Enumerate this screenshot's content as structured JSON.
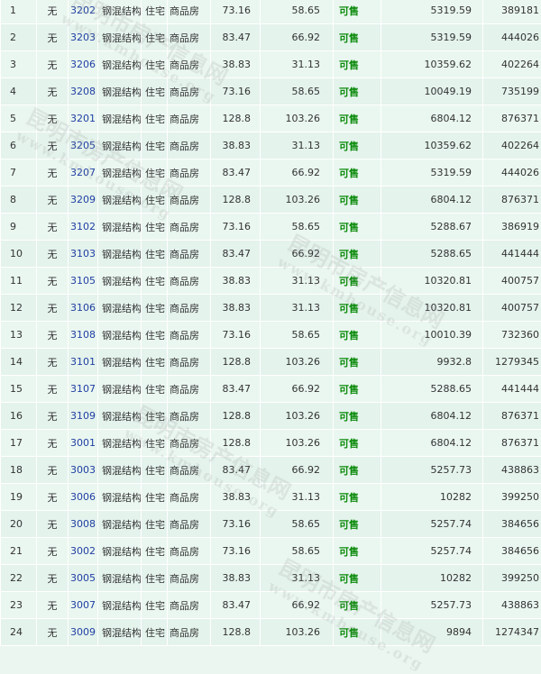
{
  "table": {
    "rows": [
      {
        "idx": "1",
        "has_none": "无",
        "room": "3202",
        "structure": "钢混结构",
        "use": "住宅",
        "type": "商品房",
        "area": "73.16",
        "inner_area": "58.65",
        "status": "可售",
        "unit_price": "5319.59",
        "total_price": "389181"
      },
      {
        "idx": "2",
        "has_none": "无",
        "room": "3203",
        "structure": "钢混结构",
        "use": "住宅",
        "type": "商品房",
        "area": "83.47",
        "inner_area": "66.92",
        "status": "可售",
        "unit_price": "5319.59",
        "total_price": "444026"
      },
      {
        "idx": "3",
        "has_none": "无",
        "room": "3206",
        "structure": "钢混结构",
        "use": "住宅",
        "type": "商品房",
        "area": "38.83",
        "inner_area": "31.13",
        "status": "可售",
        "unit_price": "10359.62",
        "total_price": "402264"
      },
      {
        "idx": "4",
        "has_none": "无",
        "room": "3208",
        "structure": "钢混结构",
        "use": "住宅",
        "type": "商品房",
        "area": "73.16",
        "inner_area": "58.65",
        "status": "可售",
        "unit_price": "10049.19",
        "total_price": "735199"
      },
      {
        "idx": "5",
        "has_none": "无",
        "room": "3201",
        "structure": "钢混结构",
        "use": "住宅",
        "type": "商品房",
        "area": "128.8",
        "inner_area": "103.26",
        "status": "可售",
        "unit_price": "6804.12",
        "total_price": "876371"
      },
      {
        "idx": "6",
        "has_none": "无",
        "room": "3205",
        "structure": "钢混结构",
        "use": "住宅",
        "type": "商品房",
        "area": "38.83",
        "inner_area": "31.13",
        "status": "可售",
        "unit_price": "10359.62",
        "total_price": "402264"
      },
      {
        "idx": "7",
        "has_none": "无",
        "room": "3207",
        "structure": "钢混结构",
        "use": "住宅",
        "type": "商品房",
        "area": "83.47",
        "inner_area": "66.92",
        "status": "可售",
        "unit_price": "5319.59",
        "total_price": "444026"
      },
      {
        "idx": "8",
        "has_none": "无",
        "room": "3209",
        "structure": "钢混结构",
        "use": "住宅",
        "type": "商品房",
        "area": "128.8",
        "inner_area": "103.26",
        "status": "可售",
        "unit_price": "6804.12",
        "total_price": "876371"
      },
      {
        "idx": "9",
        "has_none": "无",
        "room": "3102",
        "structure": "钢混结构",
        "use": "住宅",
        "type": "商品房",
        "area": "73.16",
        "inner_area": "58.65",
        "status": "可售",
        "unit_price": "5288.67",
        "total_price": "386919"
      },
      {
        "idx": "10",
        "has_none": "无",
        "room": "3103",
        "structure": "钢混结构",
        "use": "住宅",
        "type": "商品房",
        "area": "83.47",
        "inner_area": "66.92",
        "status": "可售",
        "unit_price": "5288.65",
        "total_price": "441444"
      },
      {
        "idx": "11",
        "has_none": "无",
        "room": "3105",
        "structure": "钢混结构",
        "use": "住宅",
        "type": "商品房",
        "area": "38.83",
        "inner_area": "31.13",
        "status": "可售",
        "unit_price": "10320.81",
        "total_price": "400757"
      },
      {
        "idx": "12",
        "has_none": "无",
        "room": "3106",
        "structure": "钢混结构",
        "use": "住宅",
        "type": "商品房",
        "area": "38.83",
        "inner_area": "31.13",
        "status": "可售",
        "unit_price": "10320.81",
        "total_price": "400757"
      },
      {
        "idx": "13",
        "has_none": "无",
        "room": "3108",
        "structure": "钢混结构",
        "use": "住宅",
        "type": "商品房",
        "area": "73.16",
        "inner_area": "58.65",
        "status": "可售",
        "unit_price": "10010.39",
        "total_price": "732360"
      },
      {
        "idx": "14",
        "has_none": "无",
        "room": "3101",
        "structure": "钢混结构",
        "use": "住宅",
        "type": "商品房",
        "area": "128.8",
        "inner_area": "103.26",
        "status": "可售",
        "unit_price": "9932.8",
        "total_price": "1279345"
      },
      {
        "idx": "15",
        "has_none": "无",
        "room": "3107",
        "structure": "钢混结构",
        "use": "住宅",
        "type": "商品房",
        "area": "83.47",
        "inner_area": "66.92",
        "status": "可售",
        "unit_price": "5288.65",
        "total_price": "441444"
      },
      {
        "idx": "16",
        "has_none": "无",
        "room": "3109",
        "structure": "钢混结构",
        "use": "住宅",
        "type": "商品房",
        "area": "128.8",
        "inner_area": "103.26",
        "status": "可售",
        "unit_price": "6804.12",
        "total_price": "876371"
      },
      {
        "idx": "17",
        "has_none": "无",
        "room": "3001",
        "structure": "钢混结构",
        "use": "住宅",
        "type": "商品房",
        "area": "128.8",
        "inner_area": "103.26",
        "status": "可售",
        "unit_price": "6804.12",
        "total_price": "876371"
      },
      {
        "idx": "18",
        "has_none": "无",
        "room": "3003",
        "structure": "钢混结构",
        "use": "住宅",
        "type": "商品房",
        "area": "83.47",
        "inner_area": "66.92",
        "status": "可售",
        "unit_price": "5257.73",
        "total_price": "438863"
      },
      {
        "idx": "19",
        "has_none": "无",
        "room": "3006",
        "structure": "钢混结构",
        "use": "住宅",
        "type": "商品房",
        "area": "38.83",
        "inner_area": "31.13",
        "status": "可售",
        "unit_price": "10282",
        "total_price": "399250"
      },
      {
        "idx": "20",
        "has_none": "无",
        "room": "3008",
        "structure": "钢混结构",
        "use": "住宅",
        "type": "商品房",
        "area": "73.16",
        "inner_area": "58.65",
        "status": "可售",
        "unit_price": "5257.74",
        "total_price": "384656"
      },
      {
        "idx": "21",
        "has_none": "无",
        "room": "3002",
        "structure": "钢混结构",
        "use": "住宅",
        "type": "商品房",
        "area": "73.16",
        "inner_area": "58.65",
        "status": "可售",
        "unit_price": "5257.74",
        "total_price": "384656"
      },
      {
        "idx": "22",
        "has_none": "无",
        "room": "3005",
        "structure": "钢混结构",
        "use": "住宅",
        "type": "商品房",
        "area": "38.83",
        "inner_area": "31.13",
        "status": "可售",
        "unit_price": "10282",
        "total_price": "399250"
      },
      {
        "idx": "23",
        "has_none": "无",
        "room": "3007",
        "structure": "钢混结构",
        "use": "住宅",
        "type": "商品房",
        "area": "83.47",
        "inner_area": "66.92",
        "status": "可售",
        "unit_price": "5257.73",
        "total_price": "438863"
      },
      {
        "idx": "24",
        "has_none": "无",
        "room": "3009",
        "structure": "钢混结构",
        "use": "住宅",
        "type": "商品房",
        "area": "128.8",
        "inner_area": "103.26",
        "status": "可售",
        "unit_price": "9894",
        "total_price": "1274347"
      }
    ]
  },
  "watermark": {
    "text": "昆明市房产信息网",
    "url": "www.kmhouse.org"
  },
  "colors": {
    "row_bg": "#eaf7f0",
    "room_link": "#1f3ea3",
    "status_available": "#0a8a0a"
  }
}
